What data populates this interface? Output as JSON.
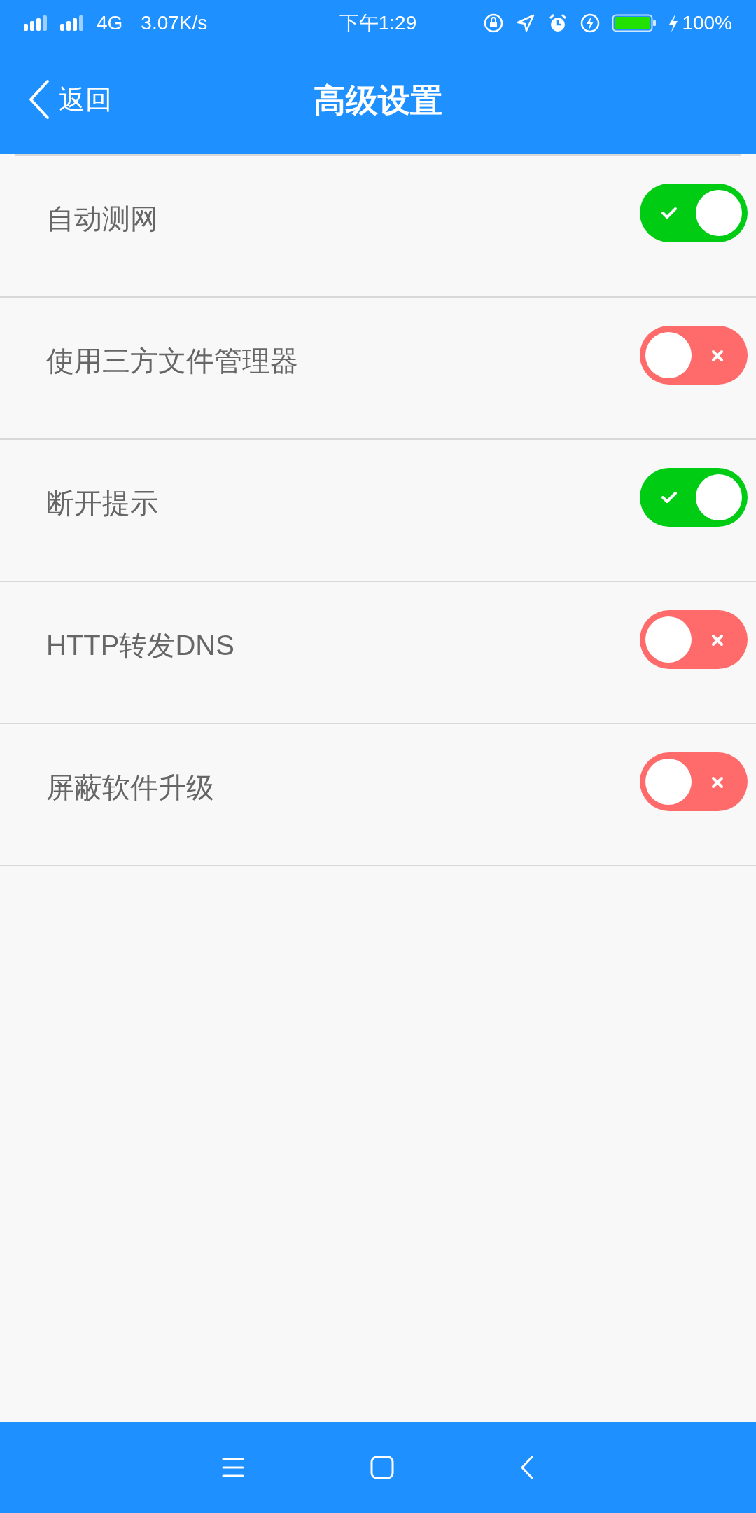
{
  "status_bar": {
    "network": "4G",
    "speed": "3.07K/s",
    "time": "下午1:29",
    "battery": "100%"
  },
  "header": {
    "back": "返回",
    "title": "高级设置"
  },
  "settings": [
    {
      "label": "自动测网",
      "on": true
    },
    {
      "label": "使用三方文件管理器",
      "on": false
    },
    {
      "label": "断开提示",
      "on": true
    },
    {
      "label": "HTTP转发DNS",
      "on": false
    },
    {
      "label": "屏蔽软件升级",
      "on": false
    }
  ]
}
